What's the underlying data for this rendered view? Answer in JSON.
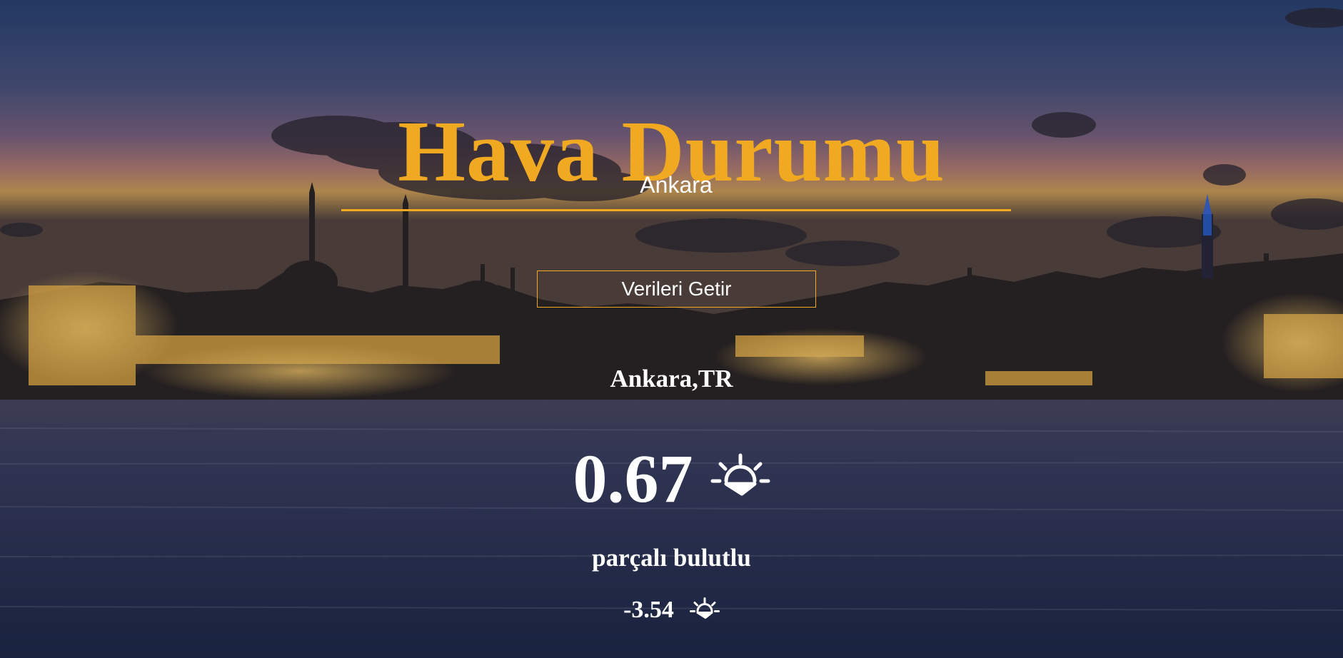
{
  "title": "Hava Durumu",
  "search": {
    "value": "Ankara",
    "placeholder": ""
  },
  "fetch_button_label": "Verileri Getir",
  "location": "Ankara,TR",
  "temperature": "0.67",
  "description": "parçalı bulutlu",
  "feels_like": "-3.54",
  "icons": {
    "weather": "sunrise-icon",
    "feels_like": "sunrise-icon"
  },
  "colors": {
    "accent": "#f2a922",
    "text": "#ffffff",
    "sky_top": "#2e4a7e",
    "sky_mid": "#8a6a8a",
    "horizon": "#d9a35a",
    "water": "#2a3658"
  }
}
